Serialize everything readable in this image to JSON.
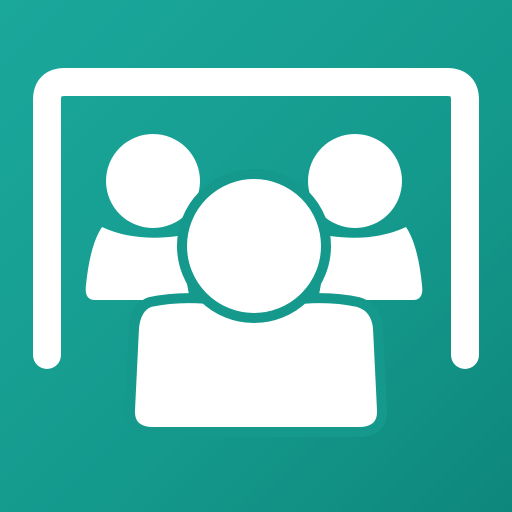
{
  "icon": {
    "name": "group-meeting-icon",
    "background_color": "#14998c",
    "foreground_color": "#ffffff",
    "elements": [
      "screen-frame-icon",
      "person-left-icon",
      "person-right-icon",
      "person-center-icon"
    ]
  }
}
